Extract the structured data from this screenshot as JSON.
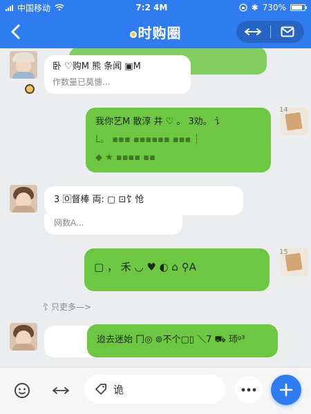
{
  "status_bar": {
    "carrier": "中国移动",
    "time": "7:2 4M",
    "battery": "730%"
  },
  "header": {
    "title": "时购圈"
  },
  "messages": [
    {
      "side": "left",
      "line1": "卧 ♡购M 熊 条闻 ▣M",
      "line2": "作数量已莫憓..."
    },
    {
      "side": "right",
      "line1": "我你艺M 散淳 井᠋ ♡ 。 3劝。 讠",
      "line2": "L。 ▪▪▪ ▪▪▪▪▪▪ ▪▪▪ ┆",
      "line3": "◆ ★ ▪▪▪▪ ▪▪",
      "time_tag": "14"
    },
    {
      "side": "left",
      "line1": "3 🄾督棒 両: ▢ ⊡饣怆",
      "sub": "网数A..."
    },
    {
      "side": "right",
      "line1": "▢ ， 禾 ◡ ♥ ◐ ⌂ ⚲A",
      "time_tag": "15"
    },
    {
      "side": "left",
      "line1": "迨去迷始  冂◎ ⊚不个▢▯ ＼7 ⛟ 㺰ᵍ³"
    }
  ],
  "more_link": "饣只吏多—>",
  "composer": {
    "placeholder": "诡"
  },
  "icons": {
    "back": "back-arrow-icon",
    "expand": "expand-arrows-icon",
    "mail": "mail-icon",
    "voice": "voice-emoji-icon",
    "swap": "swap-arrows-icon",
    "tag": "tag-icon",
    "more": "more-dots-icon",
    "plus": "plus-icon"
  },
  "colors": {
    "primary_blue": "#2f7cf0",
    "bubble_green": "#6ec743",
    "bubble_white": "#ffffff",
    "background": "#ecedef"
  }
}
